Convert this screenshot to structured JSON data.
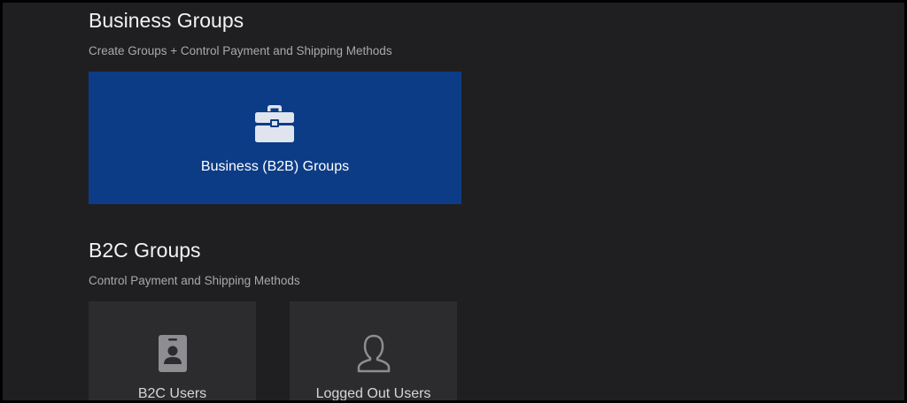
{
  "business_groups": {
    "title": "Business Groups",
    "subtitle": "Create Groups + Control Payment and Shipping Methods",
    "tile": {
      "label": "Business (B2B) Groups",
      "icon": "briefcase-icon",
      "color": "#0d3c86"
    }
  },
  "b2c_groups": {
    "title": "B2C Groups",
    "subtitle": "Control Payment and Shipping Methods",
    "tiles": [
      {
        "label": "B2C Users",
        "icon": "id-badge-icon"
      },
      {
        "label": "Logged Out Users",
        "icon": "user-outline-icon"
      }
    ]
  }
}
